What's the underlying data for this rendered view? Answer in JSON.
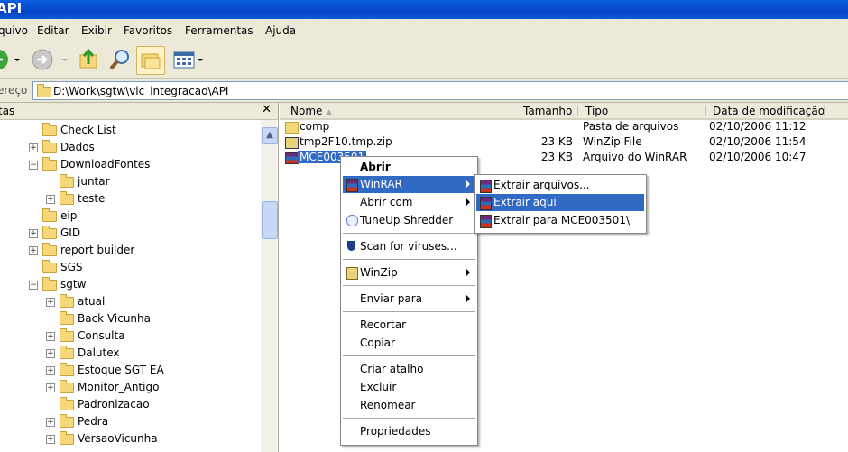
{
  "window": {
    "title": "API"
  },
  "menu": [
    "quivo",
    "Editar",
    "Exibir",
    "Favoritos",
    "Ferramentas",
    "Ajuda"
  ],
  "address": {
    "label": "ereço",
    "path": "D:\\Work\\sgtw\\vic_integracao\\API"
  },
  "left_pane": {
    "title": "tas",
    "close": "✕",
    "tree": [
      {
        "label": "Check List",
        "expand": "",
        "level": 0
      },
      {
        "label": "Dados",
        "expand": "+",
        "level": 0
      },
      {
        "label": "DownloadFontes",
        "expand": "-",
        "level": 0
      },
      {
        "label": "juntar",
        "expand": "",
        "level": 1
      },
      {
        "label": "teste",
        "expand": "+",
        "level": 1
      },
      {
        "label": "eip",
        "expand": "",
        "level": 0
      },
      {
        "label": "GID",
        "expand": "+",
        "level": 0
      },
      {
        "label": "report builder",
        "expand": "+",
        "level": 0
      },
      {
        "label": "SGS",
        "expand": "",
        "level": 0
      },
      {
        "label": "sgtw",
        "expand": "-",
        "level": 0
      },
      {
        "label": "atual",
        "expand": "+",
        "level": 1
      },
      {
        "label": "Back Vicunha",
        "expand": "",
        "level": 1
      },
      {
        "label": "Consulta",
        "expand": "+",
        "level": 1
      },
      {
        "label": "Dalutex",
        "expand": "+",
        "level": 1
      },
      {
        "label": "Estoque SGT EA",
        "expand": "+",
        "level": 1
      },
      {
        "label": "Monitor_Antigo",
        "expand": "+",
        "level": 1
      },
      {
        "label": "Padronizacao",
        "expand": "",
        "level": 1
      },
      {
        "label": "Pedra",
        "expand": "+",
        "level": 1
      },
      {
        "label": "VersaoVicunha",
        "expand": "+",
        "level": 1
      }
    ]
  },
  "columns": {
    "name": "Nome",
    "size": "Tamanho",
    "type": "Tipo",
    "date": "Data de modificação"
  },
  "files": [
    {
      "name": "comp",
      "size": "",
      "type": "Pasta de arquivos",
      "date": "02/10/2006 11:12",
      "icon": "folder-icon"
    },
    {
      "name": "tmp2F10.tmp.zip",
      "size": "23 KB",
      "type": "WinZip File",
      "date": "02/10/2006 11:54",
      "icon": "zip-icon"
    },
    {
      "name": "MCE003501",
      "size": "23 KB",
      "type": "Arquivo do WinRAR",
      "date": "02/10/2006 10:47",
      "icon": "rar-icon"
    }
  ],
  "context_menu": {
    "open": "Abrir",
    "winrar": "WinRAR",
    "open_with": "Abrir com",
    "tuneup": "TuneUp Shredder",
    "scan": "Scan for viruses...",
    "winzip": "WinZip",
    "send_to": "Enviar para",
    "cut": "Recortar",
    "copy": "Copiar",
    "shortcut": "Criar atalho",
    "delete": "Excluir",
    "rename": "Renomear",
    "properties": "Propriedades"
  },
  "submenu": {
    "extract_files": "Extrair arquivos...",
    "extract_here": "Extrair aqui",
    "extract_to": "Extrair para MCE003501\\"
  },
  "colors": {
    "selection": "#316ac5",
    "titlebar": "#0a5fe0"
  }
}
